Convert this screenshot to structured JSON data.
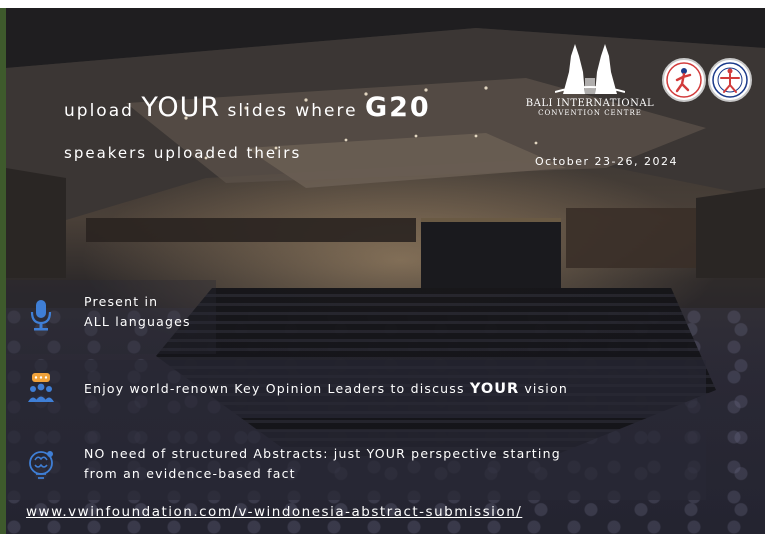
{
  "headline": {
    "line1_part1": "upload ",
    "line1_your": "YOUR",
    "line1_part2": " slides where ",
    "line1_g20": "G20",
    "line2": "speakers uploaded theirs"
  },
  "venue": {
    "name_line1": "BALI INTERNATIONAL",
    "name_line2": "CONVENTION CENTRE"
  },
  "date": "October 23-26, 2024",
  "features": [
    {
      "line1": "Present in",
      "line2": "ALL languages",
      "icon": "microphone-icon"
    },
    {
      "part1": "Enjoy world-renown Key Opinion Leaders to discuss ",
      "your": "YOUR",
      "part2": " vision",
      "icon": "audience-discussion-icon"
    },
    {
      "line1": "NO need of structured Abstracts: just YOUR perspective starting",
      "line2": "from an evidence-based fact",
      "icon": "brain-lightbulb-icon"
    }
  ],
  "url": "www.vwinfoundation.com/v-windonesia-abstract-submission/",
  "colors": {
    "icon_blue": "#3f7fd6",
    "icon_orange": "#f0a23a",
    "left_edge_green": "#3e5a2c"
  }
}
